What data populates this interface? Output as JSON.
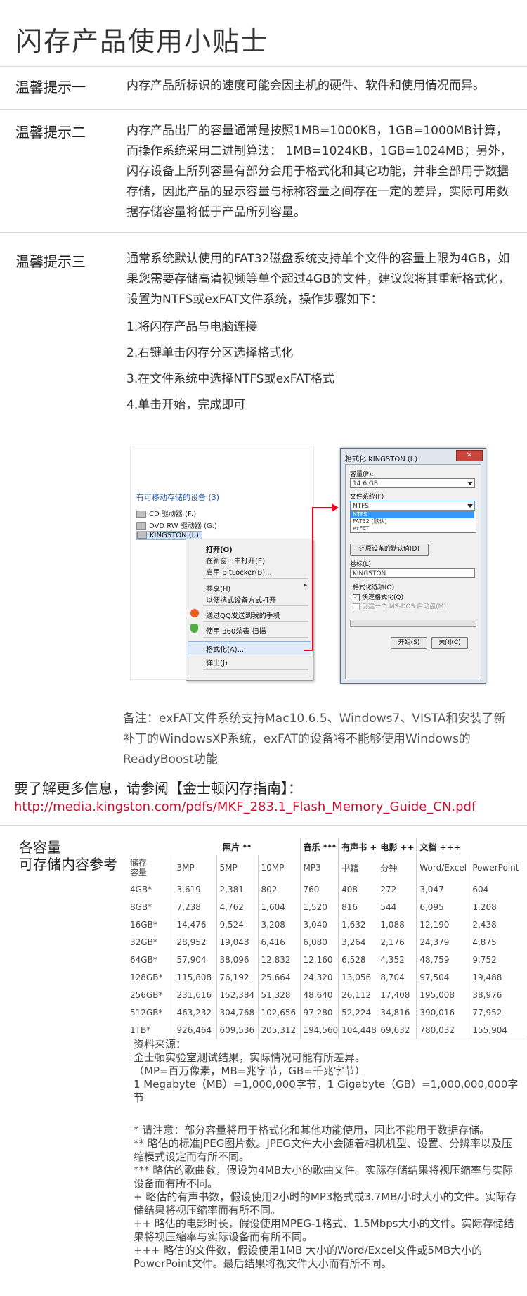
{
  "page_title": "闪存产品使用小贴士",
  "tips": [
    {
      "heading": "温馨提示一",
      "text": "内存产品所标识的速度可能会因主机的硬件、软件和使用情况而异。"
    },
    {
      "heading": "温馨提示二",
      "text": "内存产品出厂的容量通常是按照1MB=1000KB，1GB=1000MB计算，而操作系统采用二进制算法： 1MB=1024KB，1GB=1024MB；另外，闪存设备上所列容量有部分会用于格式化和其它功能，并非全部用于数据存储，因此产品的显示容量与标称容量之间存在一定的差异，实际可用数据存储容量将低于产品所列容量。"
    },
    {
      "heading": "温馨提示三",
      "text": "通常系统默认使用的FAT32磁盘系统支持单个文件的容量上限为4GB，如果您需要存储高清视频等单个超过4GB的文件，建议您将其重新格式化，设置为NTFS或exFAT文件系统，操作步骤如下：",
      "steps": [
        "1.将闪存产品与电脑连接",
        "2.右键单击闪存分区选择格式化",
        "3.在文件系统中选择NTFS或exFAT格式",
        "4.单击开始，完成即可"
      ]
    }
  ],
  "explorer": {
    "section_label": "有可移动存储的设备 (3)",
    "drives": [
      "CD 驱动器 (F:)",
      "DVD RW 驱动器 (G:)",
      "KINGSTON (I:)"
    ],
    "menu": [
      "打开(O)",
      "在新窗口中打开(E)",
      "启用 BitLocker(B)...",
      "共享(H)",
      "以便携式设备方式打开",
      "通过QQ发送到我的手机",
      "使用 360杀毒 扫描",
      "格式化(A)...",
      "弹出(J)"
    ],
    "menu_arrow": "▸"
  },
  "format_dialog": {
    "title": "格式化 KINGSTON (I:)",
    "close": "✕",
    "capacity_label": "容量(P):",
    "capacity_value": "14.6 GB",
    "fs_label": "文件系统(F)",
    "fs_value": "NTFS",
    "fs_options": [
      "NTFS",
      "FAT32 (默认)",
      "exFAT"
    ],
    "restore_button": "还原设备的默认值(D)",
    "volume_label": "卷标(L)",
    "volume_value": "KINGSTON",
    "options_label": "格式化选项(O)",
    "quick_format": "快速格式化(Q)",
    "msdos_disk": "创建一个 MS-DOS 启动盘(M)",
    "check_mark": "✓",
    "start_button": "开始(S)",
    "close_button": "关闭(C)"
  },
  "note": "备注：exFAT文件系统支持Mac10.6.5、Windows7、VISTA和安装了新补丁的WindowsXP系统，exFAT的设备将不能够使用Windows的ReadyBoost功能",
  "more_info": "要了解更多信息，请参阅【金士顿闪存指南】：",
  "link": "http://media.kingston.com/pdfs/MKF_283.1_Flash_Memory_Guide_CN.pdf",
  "capacity_heading": [
    "各容量",
    "可存储内容参考"
  ],
  "table": {
    "group_headers": [
      "照片 **",
      "音乐 ***",
      "有声书 +",
      "电影 ++",
      "文档 +++"
    ],
    "sub_headers": [
      "储存\n容量",
      "3MP",
      "5MP",
      "10MP",
      "MP3",
      "书籍",
      "分钟",
      "Word/Excel",
      "PowerPoint"
    ],
    "rows": [
      [
        "4GB*",
        "3,619",
        "2,381",
        "802",
        "760",
        "408",
        "272",
        "3,047",
        "604"
      ],
      [
        "8GB*",
        "7,238",
        "4,762",
        "1,604",
        "1,520",
        "816",
        "544",
        "6,095",
        "1,208"
      ],
      [
        "16GB*",
        "14,476",
        "9,524",
        "3,208",
        "3,040",
        "1,632",
        "1,088",
        "12,190",
        "2,438"
      ],
      [
        "32GB*",
        "28,952",
        "19,048",
        "6,416",
        "6,080",
        "3,264",
        "2,176",
        "24,379",
        "4,875"
      ],
      [
        "64GB*",
        "57,904",
        "38,096",
        "12,832",
        "12,160",
        "6,528",
        "4,352",
        "48,759",
        "9,752"
      ],
      [
        "128GB*",
        "115,808",
        "76,192",
        "25,664",
        "24,320",
        "13,056",
        "8,704",
        "97,504",
        "19,488"
      ],
      [
        "256GB*",
        "231,616",
        "152,384",
        "51,328",
        "48,640",
        "26,112",
        "17,408",
        "195,008",
        "38,976"
      ],
      [
        "512GB*",
        "463,232",
        "304,768",
        "102,656",
        "97,280",
        "52,224",
        "34,816",
        "390,016",
        "77,952"
      ],
      [
        "1TB*",
        "926,464",
        "609,536",
        "205,312",
        "194,560",
        "104,448",
        "69,632",
        "780,032",
        "155,904"
      ]
    ]
  },
  "source": [
    "资料来源：",
    "金士顿实验室测试结果，实际情况可能有所差异。",
    "（MP=百万像素，MB=兆字节，GB=千兆字节）",
    "1 Megabyte（MB）=1,000,000字节，1 Gigabyte（GB）=1,000,000,000字节"
  ],
  "footnotes": [
    "* 请注意：部分容量将用于格式化和其他功能使用，因此不能用于数据存储。",
    "** 略估的标准JPEG图片数。JPEG文件大小会随着相机机型、设置、分辨率以及压缩模式设定而有所不同。",
    "*** 略估的歌曲数，假设为4MB大小的歌曲文件。实际存储结果将视压缩率与实际设备而有所不同。",
    "+ 略估的有声书数，假设使用2小时的MP3格式或3.7MB/小时大小的文件。实际存储结果将视压缩率而有所不同。",
    "++ 略估的电影时长，假设使用MPEG-1格式、1.5Mbps大小的文件。实际存储结果将视压缩率与实际设备而有所不同。",
    "+++ 略估的文件数，假设使用1MB 大小的Word/Excel文件或5MB大小的PowerPoint文件。最后结果将视文件大小而有所不同。"
  ]
}
